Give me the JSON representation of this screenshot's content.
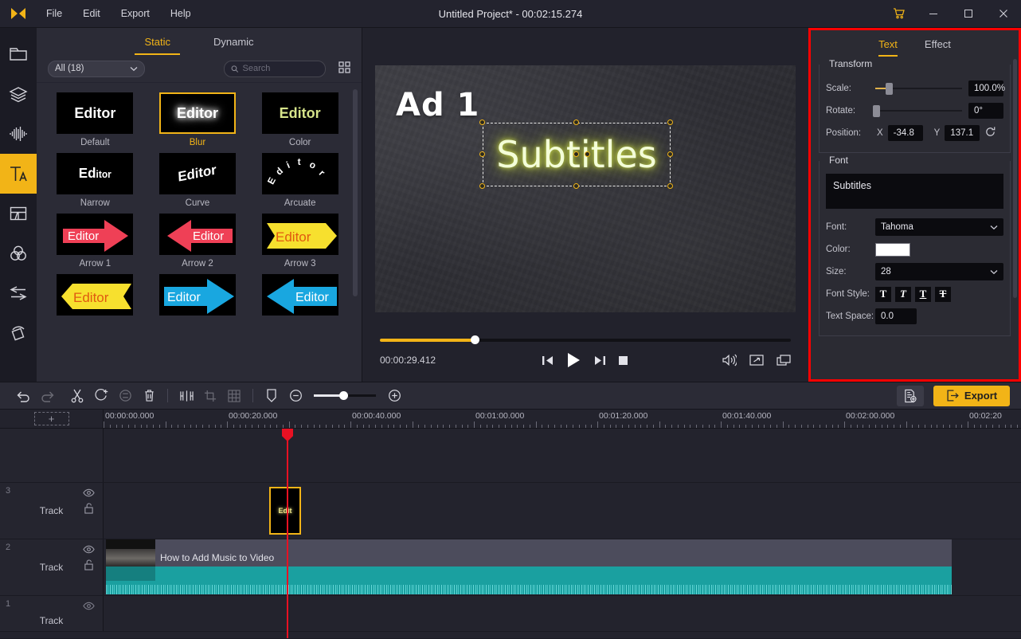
{
  "titlebar": {
    "logo_icon": "app-logo-icon",
    "menus": [
      "File",
      "Edit",
      "Export",
      "Help"
    ],
    "project_title": "Untitled Project* - 00:02:15.274",
    "cart_icon": "cart-icon",
    "minimize_icon": "minimize-icon",
    "maximize_icon": "maximize-icon",
    "close_icon": "close-icon"
  },
  "rail": {
    "items": [
      {
        "name": "media",
        "icon": "folder-icon",
        "active": false
      },
      {
        "name": "stickers",
        "icon": "layers-icon",
        "active": false
      },
      {
        "name": "audio",
        "icon": "audio-wave-icon",
        "active": false
      },
      {
        "name": "text",
        "icon": "text-icon",
        "active": true
      },
      {
        "name": "split-screen",
        "icon": "split-screen-icon",
        "active": false
      },
      {
        "name": "filters",
        "icon": "color-circles-icon",
        "active": false
      },
      {
        "name": "transitions",
        "icon": "transitions-icon",
        "active": false
      },
      {
        "name": "overlays",
        "icon": "rotate-square-icon",
        "active": false
      }
    ]
  },
  "library": {
    "tabs": [
      {
        "label": "Static",
        "active": true
      },
      {
        "label": "Dynamic",
        "active": false
      }
    ],
    "category": "All (18)",
    "category_chevron": "chevron-down-icon",
    "search_placeholder": "Search",
    "search_value": "",
    "search_icon": "search-icon",
    "grid_view_icon": "grid-view-icon",
    "presets": [
      {
        "label": "Default",
        "style": "default",
        "selected": false
      },
      {
        "label": "Blur",
        "style": "blur",
        "selected": true
      },
      {
        "label": "Color",
        "style": "color",
        "selected": false
      },
      {
        "label": "Narrow",
        "style": "narrow",
        "selected": false
      },
      {
        "label": "Curve",
        "style": "curve",
        "selected": false
      },
      {
        "label": "Arcuate",
        "style": "arcuate",
        "selected": false
      },
      {
        "label": "Arrow 1",
        "style": "arrow-right-red",
        "selected": false
      },
      {
        "label": "Arrow 2",
        "style": "arrow-left-red",
        "selected": false
      },
      {
        "label": "Arrow 3",
        "style": "arrow-right-yellow",
        "selected": false
      },
      {
        "label": "",
        "style": "arrow-left-yellow",
        "selected": false
      },
      {
        "label": "",
        "style": "arrow-right-blue",
        "selected": false
      },
      {
        "label": "",
        "style": "arrow-left-blue",
        "selected": false
      }
    ],
    "preset_sample_text": "Editor"
  },
  "preview": {
    "overlay_text": "Ad 1",
    "subtitle_text": "Subtitles",
    "current_time": "00:00:29.412",
    "seek_percent": 23,
    "prev_frame_icon": "previous-frame-icon",
    "play_icon": "play-icon",
    "next_frame_icon": "next-frame-icon",
    "stop_icon": "stop-icon",
    "volume_icon": "volume-icon",
    "fullscreen_icon": "fullscreen-icon",
    "snapshot_icon": "snapshot-icon"
  },
  "props": {
    "tabs": [
      {
        "label": "Text",
        "active": true
      },
      {
        "label": "Effect",
        "active": false
      }
    ],
    "transform": {
      "title": "Transform",
      "scale_label": "Scale:",
      "scale_value": "100.0%",
      "scale_percent": 16,
      "rotate_label": "Rotate:",
      "rotate_value": "0°",
      "rotate_percent": 1,
      "position_label": "Position:",
      "x_label": "X",
      "x_value": "-34.8",
      "y_label": "Y",
      "y_value": "137.1",
      "reset_icon": "reset-icon"
    },
    "font": {
      "title": "Font",
      "text_value": "Subtitles",
      "font_label": "Font:",
      "font_value": "Tahoma",
      "color_label": "Color:",
      "color_value": "#ffffff",
      "size_label": "Size:",
      "size_value": "28",
      "font_style_label": "Font Style:",
      "style_buttons": [
        "bold-icon",
        "italic-icon",
        "underline-icon",
        "strikethrough-icon"
      ],
      "style_glyphs": [
        "T",
        "T",
        "T",
        "T"
      ],
      "text_space_label": "Text Space:",
      "text_space_value": "0.0"
    }
  },
  "toolbar": {
    "undo_icon": "undo-icon",
    "redo_icon": "redo-icon",
    "cut_icon": "scissors-icon",
    "add_icon": "add-clip-icon",
    "duplicate_icon": "duplicate-icon",
    "delete_icon": "trash-icon",
    "split_icon": "split-icon",
    "crop_icon": "crop-icon",
    "mosaic_icon": "mosaic-icon",
    "marker_icon": "marker-icon",
    "zoom_out_icon": "zoom-out-icon",
    "zoom_in_icon": "zoom-in-icon",
    "zoom_percent": 48,
    "settings_icon": "settings-icon",
    "export_label": "Export",
    "export_icon": "export-arrow-icon",
    "export_color": "#f2b417"
  },
  "timeline": {
    "add_track_label": "+",
    "ruler_labels": [
      "00:00:00.000",
      "00:00:20.000",
      "00:00:40.000",
      "00:01:00.000",
      "00:01:20.000",
      "00:01:40.000",
      "00:02:00.000",
      "00:02:20"
    ],
    "playhead_time": "00:00:20.000",
    "tracks": [
      {
        "number": "3",
        "name": "Track",
        "eye_icon": "eye-icon",
        "lock_icon": "unlock-icon"
      },
      {
        "number": "2",
        "name": "Track",
        "eye_icon": "eye-icon",
        "lock_icon": "unlock-icon"
      },
      {
        "number": "1",
        "name": "Track",
        "eye_icon": "eye-icon",
        "lock_icon": "unlock-icon"
      }
    ],
    "text_clip_label": "Edit",
    "video_clip_label": "How to Add Music to Video",
    "audio_color": "#1aa0a0"
  }
}
